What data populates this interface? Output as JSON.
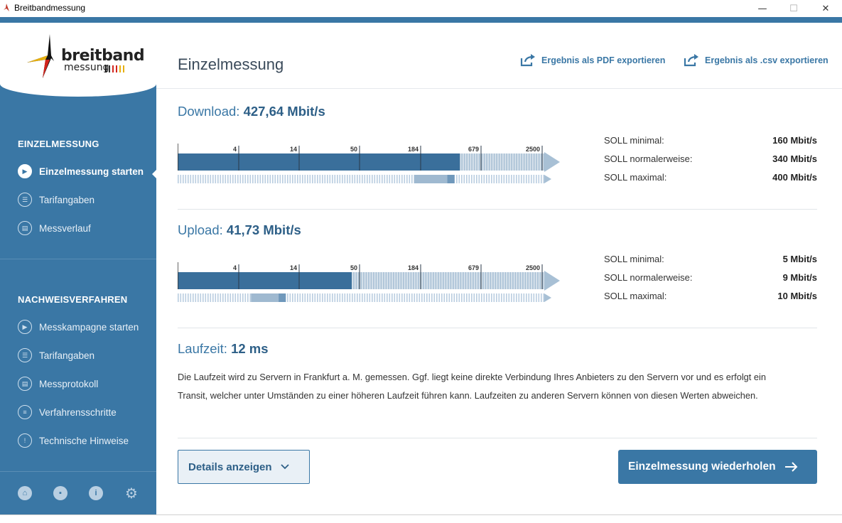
{
  "window": {
    "title": "Breitbandmessung",
    "minimize": "—",
    "maximize": "☐",
    "close": "✕"
  },
  "logo": {
    "line1": "breitband",
    "line2": "messung"
  },
  "sidebar": {
    "section1_title": "EINZELMESSUNG",
    "section1_items": [
      {
        "label": "Einzelmessung starten",
        "icon": "play-icon",
        "active": true
      },
      {
        "label": "Tarifangaben",
        "icon": "user-card-icon",
        "active": false
      },
      {
        "label": "Messverlauf",
        "icon": "clipboard-icon",
        "active": false
      }
    ],
    "section2_title": "NACHWEISVERFAHREN",
    "section2_items": [
      {
        "label": "Messkampagne starten",
        "icon": "play-icon"
      },
      {
        "label": "Tarifangaben",
        "icon": "user-card-icon"
      },
      {
        "label": "Messprotokoll",
        "icon": "clipboard-icon"
      },
      {
        "label": "Verfahrensschritte",
        "icon": "list-icon"
      },
      {
        "label": "Technische Hinweise",
        "icon": "warning-icon"
      }
    ],
    "footer_icons": [
      "home-icon",
      "chat-icon",
      "info-icon",
      "gear-icon"
    ]
  },
  "main": {
    "title": "Einzelmessung",
    "export_pdf": "Ergebnis als PDF exportieren",
    "export_csv": "Ergebnis als .csv exportieren",
    "download": {
      "label": "Download:",
      "value": "427,64 Mbit/s",
      "scale_ticks": [
        "4",
        "14",
        "50",
        "184",
        "679",
        "2500"
      ],
      "measured_fraction": 0.77,
      "soll_range_fraction": [
        0.645,
        0.755
      ],
      "soll": [
        {
          "label": "SOLL minimal:",
          "value": "160 Mbit/s"
        },
        {
          "label": "SOLL normalerweise:",
          "value": "340 Mbit/s"
        },
        {
          "label": "SOLL maximal:",
          "value": "400 Mbit/s"
        }
      ]
    },
    "upload": {
      "label": "Upload:",
      "value": "41,73 Mbit/s",
      "scale_ticks": [
        "4",
        "14",
        "50",
        "184",
        "679",
        "2500"
      ],
      "measured_fraction": 0.475,
      "soll_range_fraction": [
        0.2,
        0.295
      ],
      "soll": [
        {
          "label": "SOLL minimal:",
          "value": "5 Mbit/s"
        },
        {
          "label": "SOLL normalerweise:",
          "value": "9 Mbit/s"
        },
        {
          "label": "SOLL maximal:",
          "value": "10 Mbit/s"
        }
      ]
    },
    "latency": {
      "label": "Laufzeit:",
      "value": "12 ms",
      "description_line1": "Die Laufzeit wird zu Servern in Frankfurt a. M. gemessen. Ggf. liegt keine direkte Verbindung Ihres Anbieters zu den Servern vor und es erfolgt ein",
      "description_line2": "Transit, welcher unter Umständen zu einer höheren Laufzeit führen kann. Laufzeiten zu anderen Servern können von diesen Werten abweichen."
    },
    "details_button": "Details anzeigen",
    "repeat_button": "Einzelmessung wiederholen",
    "colors": {
      "accent": "#3a77a5",
      "bar_fill": "#3a6f9b",
      "bar_light": "#9fb9d0"
    }
  }
}
